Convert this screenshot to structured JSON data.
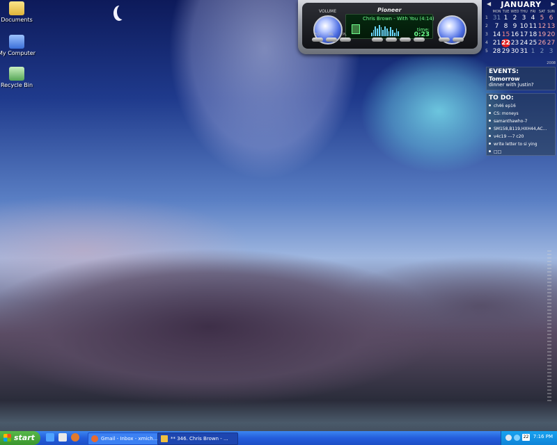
{
  "desktop": {
    "icons": [
      {
        "label": "Documents"
      },
      {
        "label": "My Computer"
      },
      {
        "label": "Recycle Bin"
      }
    ]
  },
  "player": {
    "brand": "Pioneer",
    "volume_label": "VOLUME",
    "track": "Chris Brown - With You (4:14)",
    "time_label": "time:",
    "time_value": "0:23",
    "buttons": [
      "EQ",
      "ML",
      "PL"
    ],
    "spectrum": [
      0.3,
      0.5,
      0.8,
      0.6,
      0.9,
      0.7,
      0.5,
      0.8,
      0.6,
      0.4,
      0.7,
      0.5,
      0.3,
      0.6,
      0.4
    ]
  },
  "calendar": {
    "month": "JANUARY",
    "year": "2008",
    "weekdays": [
      "MON",
      "TUE",
      "WED",
      "THU",
      "FRI",
      "SAT",
      "SUN"
    ],
    "weeks": [
      {
        "week": "1",
        "days": [
          "31",
          "1",
          "2",
          "3",
          "4",
          "5",
          "6"
        ]
      },
      {
        "week": "2",
        "days": [
          "7",
          "8",
          "9",
          "10",
          "11",
          "12",
          "13"
        ]
      },
      {
        "week": "3",
        "days": [
          "14",
          "15",
          "16",
          "17",
          "18",
          "19",
          "20"
        ]
      },
      {
        "week": "4",
        "days": [
          "21",
          "22",
          "23",
          "24",
          "25",
          "26",
          "27"
        ]
      },
      {
        "week": "5",
        "days": [
          "28",
          "29",
          "30",
          "31",
          "1",
          "2",
          "3"
        ]
      }
    ],
    "today": "22"
  },
  "events": {
    "title": "EVENTS:",
    "when": "Tomorrow",
    "what": "dinner with justin?"
  },
  "todo": {
    "title": "TO DO:",
    "items": [
      "ch46 ep16",
      "CS: moneys",
      "samanthawho-7",
      "SM158,B119,HXH44,AC...",
      "v4c19 ---7 c20",
      "write letter to si ying",
      "□□"
    ]
  },
  "taskbar": {
    "start": "start",
    "tasks": [
      {
        "label": "Gmail - Inbox - xmich..."
      },
      {
        "label": "** 346. Chris Brown - ..."
      }
    ],
    "tray_date": "22",
    "clock": "7:16 PM"
  }
}
